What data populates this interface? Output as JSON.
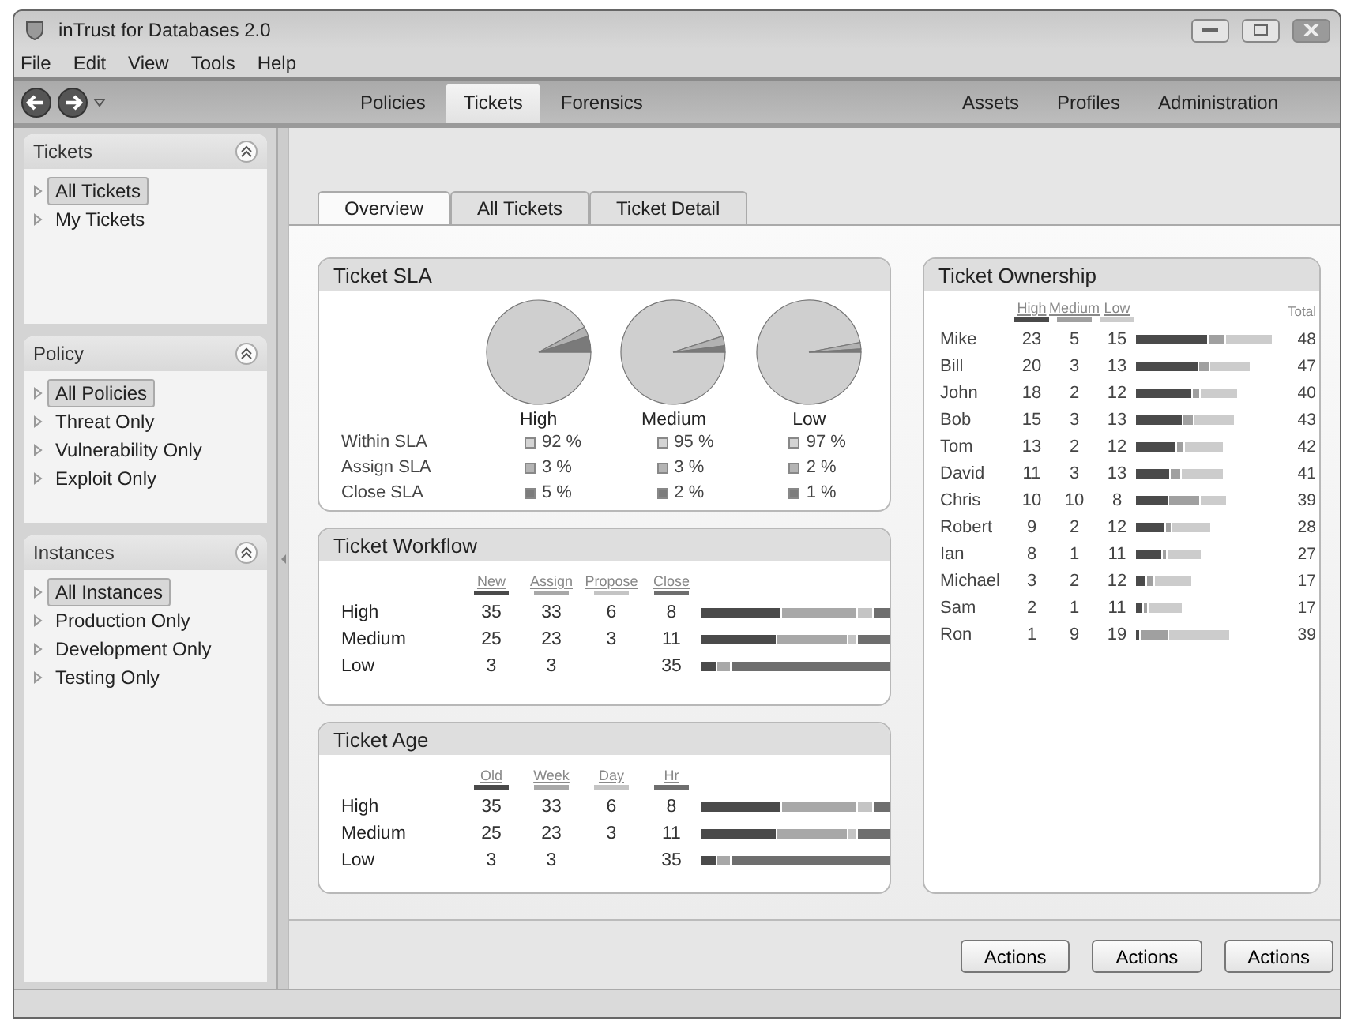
{
  "window": {
    "title": "inTrust for Databases 2.0"
  },
  "menu": [
    "File",
    "Edit",
    "View",
    "Tools",
    "Help"
  ],
  "nav_groups": [
    {
      "tabs": [
        {
          "label": "Policies",
          "selected": false
        },
        {
          "label": "Tickets",
          "selected": true
        },
        {
          "label": "Forensics",
          "selected": false
        }
      ]
    },
    {
      "tabs": [
        {
          "label": "Assets",
          "selected": false
        },
        {
          "label": "Profiles",
          "selected": false
        },
        {
          "label": "Administration",
          "selected": false
        }
      ]
    }
  ],
  "sidebar": [
    {
      "title": "Tickets",
      "expanded": true,
      "items": [
        {
          "label": "All Tickets",
          "selected": true
        },
        {
          "label": "My Tickets",
          "selected": false
        }
      ]
    },
    {
      "title": "Policy",
      "expanded": true,
      "items": [
        {
          "label": "All Policies",
          "selected": true
        },
        {
          "label": "Threat Only",
          "selected": false
        },
        {
          "label": "Vulnerability Only",
          "selected": false
        },
        {
          "label": "Exploit Only",
          "selected": false
        }
      ]
    },
    {
      "title": "Instances",
      "expanded": true,
      "items": [
        {
          "label": "All Instances",
          "selected": true
        },
        {
          "label": "Production Only",
          "selected": false
        },
        {
          "label": "Development Only",
          "selected": false
        },
        {
          "label": "Testing Only",
          "selected": false
        }
      ]
    }
  ],
  "content_tabs": [
    {
      "label": "Overview",
      "selected": true
    },
    {
      "label": "All Tickets",
      "selected": false
    },
    {
      "label": "Ticket Detail",
      "selected": false
    }
  ],
  "ticket_sla": {
    "title": "Ticket SLA",
    "charts": [
      {
        "chart_data": {
          "type": "pie",
          "title": "High",
          "values": [
            92,
            3,
            5
          ]
        }
      },
      {
        "chart_data": {
          "type": "pie",
          "title": "Medium",
          "values": [
            95,
            3,
            2
          ]
        }
      },
      {
        "chart_data": {
          "type": "pie",
          "title": "Low",
          "values": [
            97,
            2,
            1
          ]
        }
      }
    ],
    "rows": [
      {
        "label": "Within SLA",
        "color": "#d4d4d4",
        "values": [
          "92 %",
          "95 %",
          "97 %"
        ]
      },
      {
        "label": "Assign SLA",
        "color": "#b4b4b4",
        "values": [
          "3 %",
          "3 %",
          "2 %"
        ]
      },
      {
        "label": "Close SLA",
        "color": "#7c7c7c",
        "values": [
          "5 %",
          "2 %",
          "1 %"
        ]
      }
    ]
  },
  "ticket_workflow": {
    "title": "Ticket Workflow",
    "row_labels": [
      "High",
      "Medium",
      "Low"
    ],
    "columns": [
      {
        "label": "New",
        "color": "#4a4a4a",
        "values": [
          "35",
          "25",
          "3"
        ]
      },
      {
        "label": "Assign",
        "color": "#a8a8a8",
        "values": [
          "33",
          "23",
          "3"
        ]
      },
      {
        "label": "Propose",
        "color": "#c4c4c4",
        "values": [
          "6",
          "3"
        ]
      },
      {
        "label": "Close",
        "color": "#6e6e6e",
        "values": [
          "8",
          "11",
          "35"
        ]
      }
    ]
  },
  "ticket_age": {
    "title": "Ticket Age",
    "row_labels": [
      "High",
      "Medium",
      "Low"
    ],
    "columns": [
      {
        "label": "Old",
        "color": "#4a4a4a",
        "values": [
          "35",
          "25",
          "3"
        ]
      },
      {
        "label": "Week",
        "color": "#a8a8a8",
        "values": [
          "33",
          "23",
          "3"
        ]
      },
      {
        "label": "Day",
        "color": "#c4c4c4",
        "values": [
          "6",
          "3"
        ]
      },
      {
        "label": "Hr",
        "color": "#6e6e6e",
        "values": [
          "8",
          "11",
          "35"
        ]
      }
    ]
  },
  "ticket_ownership": {
    "title": "Ticket Ownership",
    "columns": [
      {
        "label": "High",
        "color": "#4a4a4a"
      },
      {
        "label": "Medium",
        "color": "#a0a0a0"
      },
      {
        "label": "Low",
        "color": "#cccccc"
      }
    ],
    "total_label": "Total",
    "rows": [
      {
        "name": "Mike",
        "values": [
          "23",
          "5",
          "15"
        ],
        "total": "48"
      },
      {
        "name": "Bill",
        "values": [
          "20",
          "3",
          "13"
        ],
        "total": "47"
      },
      {
        "name": "John",
        "values": [
          "18",
          "2",
          "12"
        ],
        "total": "40"
      },
      {
        "name": "Bob",
        "values": [
          "15",
          "3",
          "13"
        ],
        "total": "43"
      },
      {
        "name": "Tom",
        "values": [
          "13",
          "2",
          "12"
        ],
        "total": "42"
      },
      {
        "name": "David",
        "values": [
          "11",
          "3",
          "13"
        ],
        "total": "41"
      },
      {
        "name": "Chris",
        "values": [
          "10",
          "10",
          "8"
        ],
        "total": "39"
      },
      {
        "name": "Robert",
        "values": [
          "9",
          "2",
          "12"
        ],
        "total": "28"
      },
      {
        "name": "Ian",
        "values": [
          "8",
          "1",
          "11"
        ],
        "total": "27"
      },
      {
        "name": "Michael",
        "values": [
          "3",
          "2",
          "12"
        ],
        "total": "17"
      },
      {
        "name": "Sam",
        "values": [
          "2",
          "1",
          "11"
        ],
        "total": "17"
      },
      {
        "name": "Ron",
        "values": [
          "1",
          "9",
          "19"
        ],
        "total": "39"
      }
    ]
  },
  "buttons": [
    "Actions",
    "Actions",
    "Actions"
  ]
}
